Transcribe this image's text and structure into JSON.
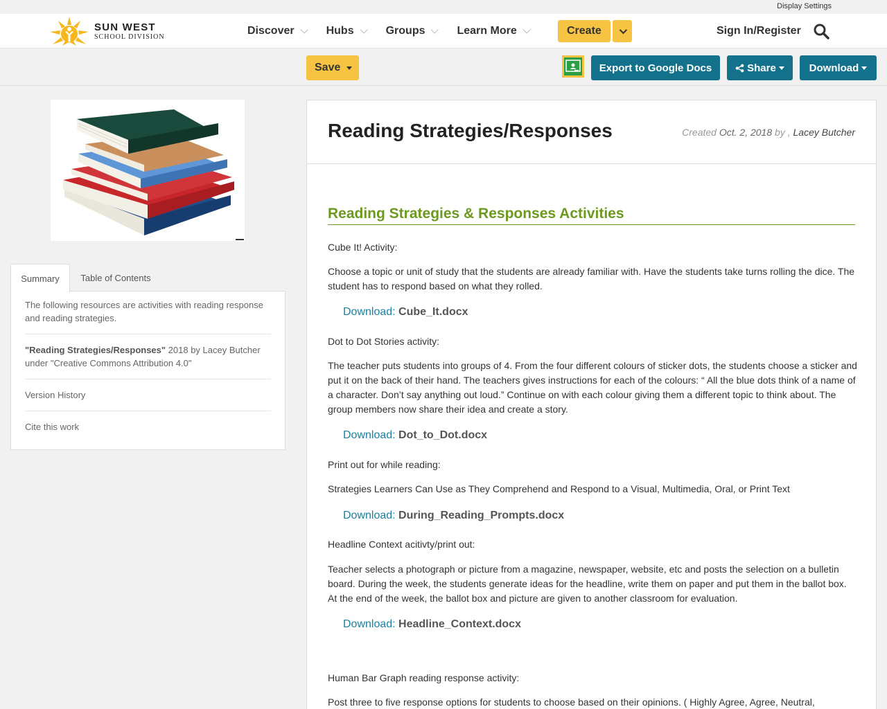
{
  "utility": {
    "display_settings": "Display Settings"
  },
  "brand": {
    "line1": "SUN WEST",
    "line2": "SCHOOL DIVISION"
  },
  "nav": {
    "items": [
      {
        "label": "Discover"
      },
      {
        "label": "Hubs"
      },
      {
        "label": "Groups"
      },
      {
        "label": "Learn More"
      }
    ],
    "create_label": "Create",
    "sign_in_label": "Sign In/Register"
  },
  "toolbar": {
    "save_label": "Save",
    "export_label": "Export to Google Docs",
    "share_label": "Share",
    "download_label": "Download"
  },
  "sidebar": {
    "tabs": [
      {
        "label": "Summary",
        "active": true
      },
      {
        "label": "Table of Contents",
        "active": false
      }
    ],
    "summary_text": "The following resources are activities with reading response and reading strategies.",
    "license_title": "\"Reading Strategies/Responses\"",
    "license_rest": " 2018 by Lacey Butcher under \"Creative Commons Attribution 4.0\"",
    "version_history": "Version History",
    "cite": "Cite this work"
  },
  "document": {
    "title": "Reading Strategies/Responses",
    "meta_created": "Created ",
    "meta_date": "Oct. 2, 2018",
    "meta_by": " by , ",
    "meta_author": "Lacey Butcher",
    "section_heading": "Reading Strategies & Responses Activities",
    "download_label": "Download: ",
    "blocks": {
      "cube_heading": "Cube It! Activity:",
      "cube_text": "Choose a topic or unit of study that the students are already familiar with. Have the students take turns rolling the dice. The student has to respond based on what they rolled.",
      "cube_file": "Cube_It.docx",
      "dot_heading": "Dot to Dot Stories activity:",
      "dot_text": "The teacher puts students into groups of 4. From the four different colours of sticker dots, the students choose a sticker and put it on the back of their hand. The teachers gives instructions for each of the colours: “ All the blue dots think of a name of a character. Don’t say anything out loud.” Continue on with each colour giving them a different topic to think about. The group members now share their idea and create a story.",
      "dot_file": "Dot_to_Dot.docx",
      "print_heading": "Print out for while reading:",
      "print_text": "Strategies Learners Can Use as They Comprehend and Respond to a Visual, Multimedia, Oral, or Print Text",
      "print_file": "During_Reading_Prompts.docx",
      "headline_heading": "Headline Context acitivty/print out:",
      "headline_text": "Teacher selects a photograph or picture from a magazine, newspaper, website, etc and posts the selection on a bulletin board. During the week, the students generate ideas for the headline, write them on paper and put them in the ballot box. At the end of the week, the ballot box and picture are given to another classroom for evaluation.",
      "headline_file": "Headline_Context.docx",
      "bargraph_heading": "Human Bar Graph reading response activity:",
      "bargraph_text": "Post three to five response options for students to choose based on their opinions. ( Highly Agree, Agree, Neutral, Disagree,"
    }
  },
  "colors": {
    "accent_yellow": "#f6c343",
    "teal_button": "#13718b",
    "link_blue": "#1c80a0",
    "heading_green": "#6b9a1f",
    "classroom_green": "#2b9f45"
  }
}
